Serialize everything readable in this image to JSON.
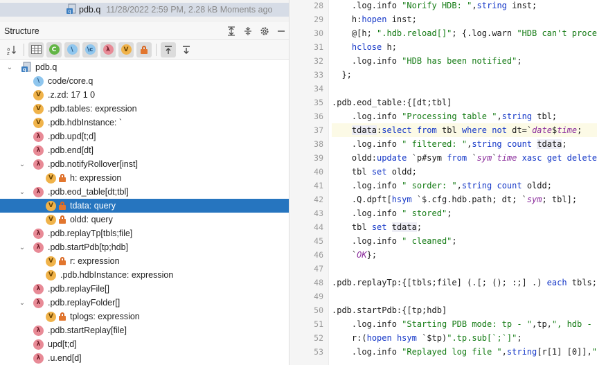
{
  "project": {
    "file_name": "pdb.q",
    "file_meta": "11/28/2022 2:59 PM, 2.28 kB Moments ago",
    "next_row_partial": "··· ·"
  },
  "structure": {
    "title": "Structure",
    "header_buttons": [
      "expand-all-icon",
      "collapse-all-icon",
      "gear-icon",
      "minimize-icon"
    ],
    "toolbar_buttons": [
      "sort-alpha-icon",
      "table-filter-icon",
      "context-filter-icon",
      "q-file-icon",
      "namespace-icon",
      "lambda-filter-icon",
      "variable-filter-icon",
      "lock-filter-icon",
      "navigate-up-icon",
      "navigate-down-icon"
    ],
    "tree": [
      {
        "label": "pdb.q",
        "icon": "file",
        "depth": 0,
        "arrow": "down"
      },
      {
        "label": "code/core.q",
        "icon": "q",
        "depth": 1,
        "arrow": ""
      },
      {
        "label": ".z.zd: 17 1 0",
        "icon": "v",
        "depth": 1,
        "arrow": ""
      },
      {
        "label": ".pdb.tables: expression",
        "icon": "v",
        "depth": 1,
        "arrow": ""
      },
      {
        "label": ".pdb.hdbInstance: `",
        "icon": "v",
        "depth": 1,
        "arrow": ""
      },
      {
        "label": ".pdb.upd[t;d]",
        "icon": "l",
        "depth": 1,
        "arrow": ""
      },
      {
        "label": ".pdb.end[dt]",
        "icon": "l",
        "depth": 1,
        "arrow": ""
      },
      {
        "label": ".pdb.notifyRollover[inst]",
        "icon": "l",
        "depth": 1,
        "arrow": "down"
      },
      {
        "label": "h: expression",
        "icon": "v",
        "lock": true,
        "depth": 2,
        "arrow": ""
      },
      {
        "label": ".pdb.eod_table[dt;tbl]",
        "icon": "l",
        "depth": 1,
        "arrow": "down"
      },
      {
        "label": "tdata: query",
        "icon": "v",
        "lock": true,
        "depth": 2,
        "arrow": "",
        "selected": true
      },
      {
        "label": "oldd: query",
        "icon": "v",
        "lock": true,
        "depth": 2,
        "arrow": ""
      },
      {
        "label": ".pdb.replayTp[tbls;file]",
        "icon": "l",
        "depth": 1,
        "arrow": ""
      },
      {
        "label": ".pdb.startPdb[tp;hdb]",
        "icon": "l",
        "depth": 1,
        "arrow": "down"
      },
      {
        "label": "r: expression",
        "icon": "v",
        "lock": true,
        "depth": 2,
        "arrow": ""
      },
      {
        "label": ".pdb.hdbInstance: expression",
        "icon": "v",
        "depth": 2,
        "arrow": ""
      },
      {
        "label": ".pdb.replayFile[]",
        "icon": "l",
        "depth": 1,
        "arrow": ""
      },
      {
        "label": ".pdb.replayFolder[]",
        "icon": "l",
        "depth": 1,
        "arrow": "down"
      },
      {
        "label": "tplogs: expression",
        "icon": "v",
        "lock": true,
        "depth": 2,
        "arrow": ""
      },
      {
        "label": ".pdb.startReplay[file]",
        "icon": "l",
        "depth": 1,
        "arrow": ""
      },
      {
        "label": "upd[t;d]",
        "icon": "l",
        "depth": 1,
        "arrow": ""
      },
      {
        "label": ".u.end[d]",
        "icon": "l",
        "depth": 1,
        "arrow": ""
      }
    ]
  },
  "editor": {
    "lines": [
      {
        "n": "28",
        "indent": 2,
        "parts": [
          [
            ".log.info ",
            ""
          ],
          [
            "\"Norify HDB: \"",
            "str"
          ],
          [
            ",",
            ""
          ],
          [
            "string",
            "kw"
          ],
          [
            " inst;",
            ""
          ]
        ]
      },
      {
        "n": "29",
        "indent": 2,
        "parts": [
          [
            "h:",
            ""
          ],
          [
            "hopen",
            "kw"
          ],
          [
            " inst;",
            ""
          ]
        ]
      },
      {
        "n": "30",
        "indent": 2,
        "parts": [
          [
            "@[h; ",
            ""
          ],
          [
            "\".hdb.reload[]\"",
            "str"
          ],
          [
            "; {.log.warn ",
            ""
          ],
          [
            "\"HDB can't process",
            "str"
          ]
        ]
      },
      {
        "n": "31",
        "indent": 2,
        "parts": [
          [
            "hclose",
            "kw"
          ],
          [
            " h;",
            ""
          ]
        ]
      },
      {
        "n": "32",
        "indent": 2,
        "parts": [
          [
            ".log.info ",
            ""
          ],
          [
            "\"HDB has been notified\"",
            "str"
          ],
          [
            ";",
            ""
          ]
        ]
      },
      {
        "n": "33",
        "indent": 1,
        "parts": [
          [
            "};",
            ""
          ]
        ]
      },
      {
        "n": "34",
        "indent": 0,
        "parts": []
      },
      {
        "n": "35",
        "indent": 0,
        "parts": [
          [
            ".pdb.eod_table:{[dt;tbl]",
            ""
          ]
        ]
      },
      {
        "n": "36",
        "indent": 2,
        "parts": [
          [
            ".log.info ",
            ""
          ],
          [
            "\"Processing table \"",
            "str"
          ],
          [
            ",",
            ""
          ],
          [
            "string",
            "kw"
          ],
          [
            " tbl;",
            ""
          ]
        ]
      },
      {
        "n": "37",
        "indent": 2,
        "current": true,
        "parts": [
          [
            "tdata",
            "var"
          ],
          [
            ":",
            ""
          ],
          [
            "select",
            "kw"
          ],
          [
            " ",
            ""
          ],
          [
            "from",
            "kw"
          ],
          [
            " tbl ",
            ""
          ],
          [
            "where",
            "kw"
          ],
          [
            " ",
            ""
          ],
          [
            "not",
            "kw"
          ],
          [
            " dt=`",
            ""
          ],
          [
            "date",
            "sym"
          ],
          [
            "$",
            ""
          ],
          [
            "time",
            "sym"
          ],
          [
            ";",
            ""
          ]
        ]
      },
      {
        "n": "38",
        "indent": 2,
        "parts": [
          [
            ".log.info ",
            ""
          ],
          [
            "\" filtered: \"",
            "str"
          ],
          [
            ",",
            ""
          ],
          [
            "string",
            "kw"
          ],
          [
            " ",
            ""
          ],
          [
            "count",
            "kw"
          ],
          [
            " ",
            ""
          ],
          [
            "tdata",
            "var"
          ],
          [
            ";",
            ""
          ]
        ]
      },
      {
        "n": "39",
        "indent": 2,
        "parts": [
          [
            "oldd:",
            ""
          ],
          [
            "update",
            "kw"
          ],
          [
            " `p#sym ",
            ""
          ],
          [
            "from",
            "kw"
          ],
          [
            " `",
            ""
          ],
          [
            "sym",
            "sym"
          ],
          [
            "`",
            ""
          ],
          [
            "time",
            "sym"
          ],
          [
            " ",
            ""
          ],
          [
            "xasc",
            "kw"
          ],
          [
            " ",
            ""
          ],
          [
            "get",
            "kw"
          ],
          [
            " ",
            ""
          ],
          [
            "delete",
            "kw"
          ],
          [
            " f",
            ""
          ]
        ]
      },
      {
        "n": "40",
        "indent": 2,
        "parts": [
          [
            "tbl ",
            ""
          ],
          [
            "set",
            "kw"
          ],
          [
            " oldd;",
            ""
          ]
        ]
      },
      {
        "n": "41",
        "indent": 2,
        "parts": [
          [
            ".log.info ",
            ""
          ],
          [
            "\" sorder: \"",
            "str"
          ],
          [
            ",",
            ""
          ],
          [
            "string",
            "kw"
          ],
          [
            " ",
            ""
          ],
          [
            "count",
            "kw"
          ],
          [
            " oldd;",
            ""
          ]
        ]
      },
      {
        "n": "42",
        "indent": 2,
        "parts": [
          [
            ".Q.dpft[",
            ""
          ],
          [
            "hsym",
            "kw"
          ],
          [
            " `$.cfg.hdb.path; dt; `",
            ""
          ],
          [
            "sym",
            "sym"
          ],
          [
            "; tbl];",
            ""
          ]
        ]
      },
      {
        "n": "43",
        "indent": 2,
        "parts": [
          [
            ".log.info ",
            ""
          ],
          [
            "\" stored\"",
            "str"
          ],
          [
            ";",
            ""
          ]
        ]
      },
      {
        "n": "44",
        "indent": 2,
        "parts": [
          [
            "tbl ",
            ""
          ],
          [
            "set",
            "kw"
          ],
          [
            " ",
            ""
          ],
          [
            "tdata",
            "var"
          ],
          [
            ";",
            ""
          ]
        ]
      },
      {
        "n": "45",
        "indent": 2,
        "parts": [
          [
            ".log.info ",
            ""
          ],
          [
            "\" cleaned\"",
            "str"
          ],
          [
            ";",
            ""
          ]
        ]
      },
      {
        "n": "46",
        "indent": 2,
        "parts": [
          [
            "`",
            ""
          ],
          [
            "OK",
            "sym"
          ],
          [
            "};",
            ""
          ]
        ]
      },
      {
        "n": "47",
        "indent": 0,
        "parts": []
      },
      {
        "n": "48",
        "indent": 0,
        "parts": [
          [
            ".pdb.replayTp:{[tbls;file] (.[; (); :;] .) ",
            ""
          ],
          [
            "each",
            "kw"
          ],
          [
            " tbls; i",
            ""
          ]
        ]
      },
      {
        "n": "49",
        "indent": 0,
        "parts": []
      },
      {
        "n": "50",
        "indent": 0,
        "parts": [
          [
            ".pdb.startPdb:{[tp;hdb]",
            ""
          ]
        ]
      },
      {
        "n": "51",
        "indent": 2,
        "parts": [
          [
            ".log.info ",
            ""
          ],
          [
            "\"Starting PDB mode: tp - \"",
            "str"
          ],
          [
            ",tp,",
            ""
          ],
          [
            "\", hdb - \"",
            "str"
          ],
          [
            ",",
            ""
          ]
        ]
      },
      {
        "n": "52",
        "indent": 2,
        "parts": [
          [
            "r:(",
            ""
          ],
          [
            "hopen",
            "kw"
          ],
          [
            " ",
            ""
          ],
          [
            "hsym",
            "kw"
          ],
          [
            " `$tp)",
            ""
          ],
          [
            "\".tp.sub[`;`]\"",
            "str"
          ],
          [
            ";",
            ""
          ]
        ]
      },
      {
        "n": "53",
        "indent": 2,
        "parts": [
          [
            ".log.info ",
            ""
          ],
          [
            "\"Replayed log file \"",
            "str"
          ],
          [
            ",",
            ""
          ],
          [
            "string",
            "kw"
          ],
          [
            "[r[1] [0]],",
            ""
          ],
          [
            "\"@\"",
            "str"
          ]
        ]
      }
    ]
  }
}
